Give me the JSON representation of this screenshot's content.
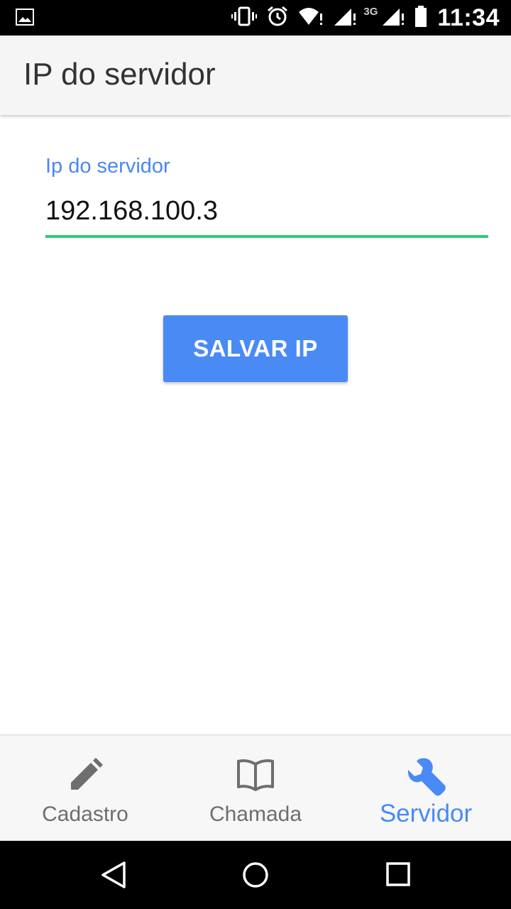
{
  "status_bar": {
    "network_label": "3G",
    "time": "11:34",
    "icons": [
      "image-notification-icon",
      "vibrate-icon",
      "alarm-icon",
      "wifi-icon",
      "signal-icon",
      "signal-icon",
      "battery-icon"
    ]
  },
  "app_bar": {
    "title": "IP do servidor"
  },
  "form": {
    "field_label": "Ip do servidor",
    "ip_value": "192.168.100.3",
    "save_label": "SALVAR IP"
  },
  "bottom_nav": {
    "items": [
      {
        "label": "Cadastro",
        "icon": "pencil-icon",
        "active": false
      },
      {
        "label": "Chamada",
        "icon": "book-icon",
        "active": false
      },
      {
        "label": "Servidor",
        "icon": "wrench-icon",
        "active": true
      }
    ]
  },
  "system_nav": {
    "buttons": [
      "back-icon",
      "home-icon",
      "recents-icon"
    ]
  },
  "colors": {
    "accent": "#4a8af4",
    "underline": "#2ecc71",
    "app_bar_bg": "#f5f5f5",
    "inactive_nav": "#6e6e6e"
  }
}
